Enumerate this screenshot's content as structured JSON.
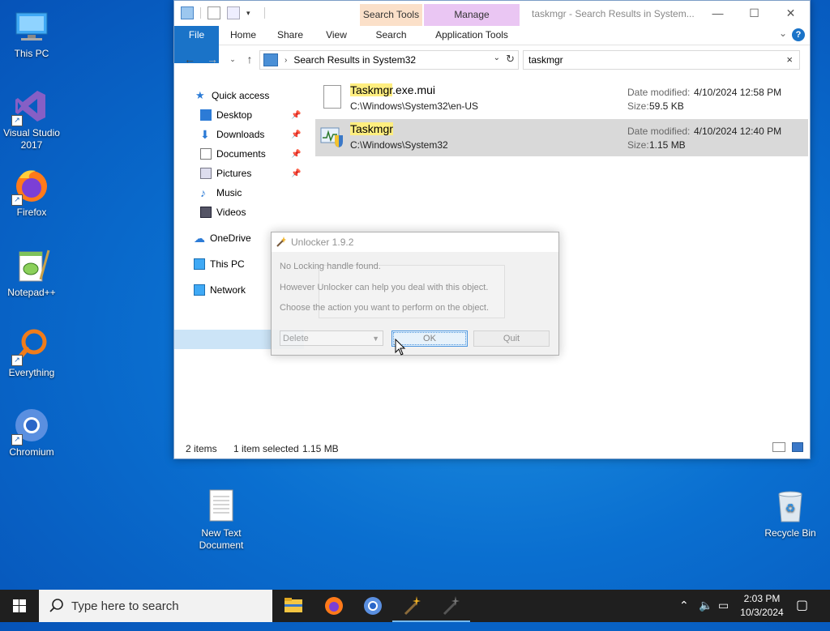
{
  "desktop": {
    "icons": [
      {
        "label": "This PC"
      },
      {
        "label": "Visual Studio 2017"
      },
      {
        "label": "Firefox"
      },
      {
        "label": "Notepad++"
      },
      {
        "label": "Everything"
      },
      {
        "label": "Chromium"
      },
      {
        "label": "New Text Document"
      },
      {
        "label": "Recycle Bin"
      }
    ]
  },
  "explorer": {
    "title": "taskmgr - Search Results in System...",
    "contextual_tabs": {
      "search_tools": "Search Tools",
      "manage": "Manage"
    },
    "ribbon_tabs": [
      "File",
      "Home",
      "Share",
      "View",
      "Search",
      "Application Tools"
    ],
    "help": "?",
    "address": {
      "path": "Search Results in System32"
    },
    "search": {
      "query": "taskmgr",
      "clear": "×"
    },
    "nav": {
      "items": [
        "Quick access",
        "Desktop",
        "Downloads",
        "Documents",
        "Pictures",
        "Music",
        "Videos",
        "OneDrive",
        "This PC",
        "Network"
      ]
    },
    "files": [
      {
        "name_hl": "Taskmgr",
        "name_rest": ".exe.mui",
        "path": "C:\\Windows\\System32\\en-US",
        "date_label": "Date modified:",
        "date": "4/10/2024 12:58 PM",
        "size_label": "Size:",
        "size": "59.5 KB"
      },
      {
        "name_hl": "Taskmgr",
        "name_rest": "",
        "path": "C:\\Windows\\System32",
        "date_label": "Date modified:",
        "date": "4/10/2024 12:40 PM",
        "size_label": "Size:",
        "size": "1.15 MB"
      }
    ],
    "status": {
      "items": "2 items",
      "selected": "1 item selected",
      "size": "1.15 MB"
    }
  },
  "dialog": {
    "title": "Unlocker 1.9.2",
    "line1": "No Locking handle found.",
    "line2": "However Unlocker can help you deal with this object.",
    "line3": "Choose the action you want to perform on the object.",
    "action_selected": "Delete",
    "ok": "OK",
    "quit": "Quit"
  },
  "taskbar": {
    "search_placeholder": "Type here to search",
    "time": "2:03 PM",
    "date": "10/3/2024"
  }
}
